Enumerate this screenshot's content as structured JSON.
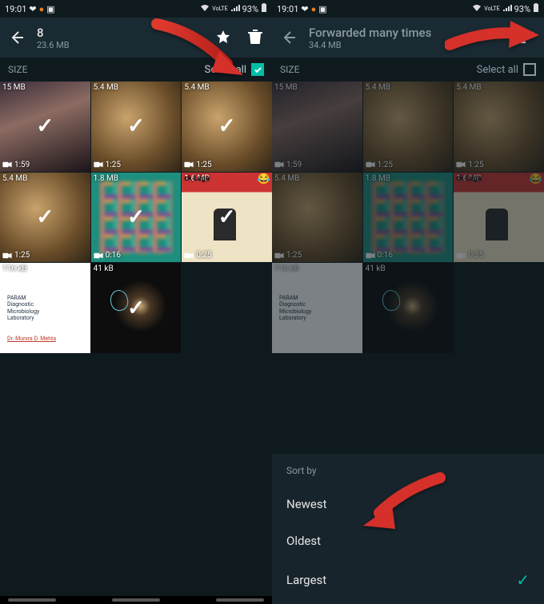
{
  "status": {
    "time": "19:01",
    "net_label": "VoLTE",
    "battery": "93%"
  },
  "left": {
    "title": "8",
    "subtitle": "23.6 MB",
    "size_label": "SIZE",
    "select_all_label": "Select all",
    "select_all_checked": true,
    "thumbs": [
      {
        "size": "15 MB",
        "dur": "1:59",
        "art": "girl",
        "video": true,
        "checked": true
      },
      {
        "size": "5.4 MB",
        "dur": "1:25",
        "art": "market",
        "video": true,
        "checked": true
      },
      {
        "size": "5.4 MB",
        "dur": "1:25",
        "art": "market",
        "video": true,
        "checked": true
      },
      {
        "size": "5.4 MB",
        "dur": "1:25",
        "art": "market",
        "video": true,
        "checked": true
      },
      {
        "size": "1.8 MB",
        "dur": "0:16",
        "art": "mosaic",
        "video": true,
        "checked": true
      },
      {
        "size": "1.6 MB",
        "dur": "0:25",
        "art": "meme",
        "video": true,
        "checked": true,
        "meme_text": "ck Laga"
      },
      {
        "size": "116 kB",
        "dur": "",
        "art": "doc",
        "video": false,
        "checked": true
      },
      {
        "size": "41 kB",
        "dur": "",
        "art": "dark",
        "video": false,
        "checked": true
      }
    ]
  },
  "right": {
    "title": "Forwarded many times",
    "subtitle": "34.4 MB",
    "size_label": "SIZE",
    "select_all_label": "Select all",
    "select_all_checked": false,
    "thumbs": [
      {
        "size": "15 MB",
        "dur": "1:59",
        "art": "girl",
        "video": true
      },
      {
        "size": "5.4 MB",
        "dur": "1:25",
        "art": "market",
        "video": true
      },
      {
        "size": "5.4 MB",
        "dur": "1:25",
        "art": "market",
        "video": true
      },
      {
        "size": "5.4 MB",
        "dur": "1:25",
        "art": "market",
        "video": true
      },
      {
        "size": "1.8 MB",
        "dur": "0:16",
        "art": "mosaic",
        "video": true
      },
      {
        "size": "1.6 MB",
        "dur": "0:25",
        "art": "meme",
        "video": true,
        "meme_text": "ck Laga"
      },
      {
        "size": "116 kB",
        "dur": "",
        "art": "doc",
        "video": false
      },
      {
        "size": "41 kB",
        "dur": "",
        "art": "dark",
        "video": false
      }
    ],
    "sort": {
      "title": "Sort by",
      "options": [
        "Newest",
        "Oldest",
        "Largest"
      ],
      "selected": "Largest"
    }
  }
}
